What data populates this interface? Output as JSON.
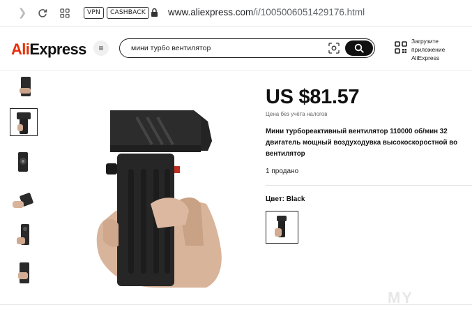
{
  "browser": {
    "vpn_label": "VPN",
    "cashback_label": "CASHBACK",
    "url_host": "www.aliexpress.com",
    "url_path": "/i/1005006051429176.html"
  },
  "header": {
    "logo_part1": "Ali",
    "logo_part2": "Express",
    "search_value": "мини турбо вентилятор",
    "app_promo": "Загрузите приложение AliExpress"
  },
  "product": {
    "price": "US $81.57",
    "tax_note": "Цена без учёта налогов",
    "title_line1": "Мини турбореактивный вентилятор 110000 об/мин 32",
    "title_line2": "двигатель мощный воздуходувка высокоскоростной во",
    "title_line3": "вентилятор",
    "sold": "1 продано",
    "color_label": "Цвет:",
    "color_value": "Black"
  },
  "thumbnails": [
    {
      "name": "thumb-1"
    },
    {
      "name": "thumb-2",
      "selected": true
    },
    {
      "name": "thumb-3"
    },
    {
      "name": "thumb-4"
    },
    {
      "name": "thumb-5"
    },
    {
      "name": "thumb-6"
    }
  ],
  "watermark": "MY"
}
